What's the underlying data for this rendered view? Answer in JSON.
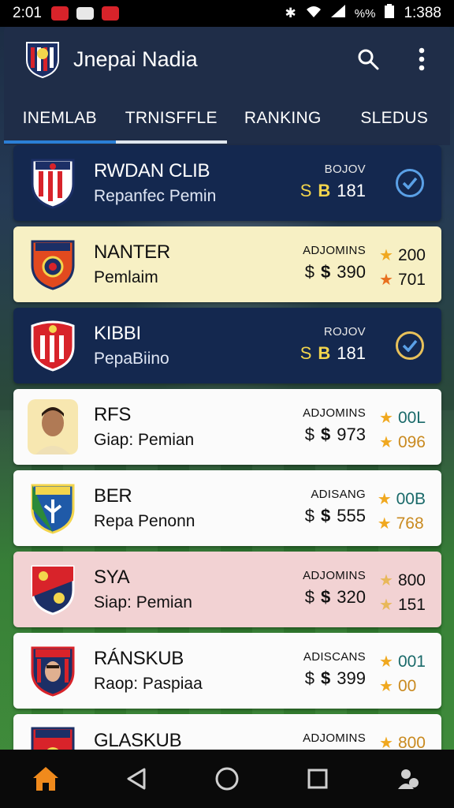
{
  "status_bar": {
    "time": "2:01",
    "right_text": "1:388",
    "signal_text": "%%",
    "battery_icon": "battery-icon"
  },
  "header": {
    "title": "Jnepai Nadia",
    "search_icon": "search-icon",
    "more_icon": "more-vert-icon"
  },
  "tabs": [
    {
      "label": "INEMLAB"
    },
    {
      "label": "TRNISFFLE"
    },
    {
      "label": "RANKING"
    },
    {
      "label": "SLEDUS"
    }
  ],
  "active_tab_index": 1,
  "clubs": [
    {
      "name": "RWDAN CLIB",
      "sub": "Repanfec Pemin",
      "label": "BOJOV",
      "sym1": "S",
      "sym2": "B",
      "price": "181",
      "theme": "dark",
      "action": "check-icon"
    },
    {
      "name": "NANTER",
      "sub": "Pemlaim",
      "label": "ADJOMINS",
      "sym1": "$",
      "sym2": "$",
      "price": "390",
      "theme": "cream",
      "stat1": "200",
      "stat2": "701"
    },
    {
      "name": "KIBBI",
      "sub": "PepaBiino",
      "label": "ROJOV",
      "sym1": "S",
      "sym2": "B",
      "price": "181",
      "theme": "dark",
      "action": "check-icon"
    },
    {
      "name": "RFS",
      "sub": "Giap: Pemian",
      "label": "ADJOMINS",
      "sym1": "$",
      "sym2": "$",
      "price": "973",
      "theme": "white",
      "stat1": "00L",
      "stat2": "096"
    },
    {
      "name": "BER",
      "sub": "Repa Penonn",
      "label": "ADISANG",
      "sym1": "$",
      "sym2": "$",
      "price": "555",
      "theme": "white",
      "stat1": "00B",
      "stat2": "768"
    },
    {
      "name": "SYA",
      "sub": "Siap: Pemian",
      "label": "ADJOMINS",
      "sym1": "$",
      "sym2": "$",
      "price": "320",
      "theme": "pink",
      "stat1": "800",
      "stat2": "151"
    },
    {
      "name": "RÁNSKUB",
      "sub": "Raop: Paspiaa",
      "label": "ADISCANS",
      "sym1": "$",
      "sym2": "$",
      "price": "399",
      "theme": "white",
      "stat1": "001",
      "stat2": "00"
    },
    {
      "name": "GLASKUB",
      "sub": "",
      "label": "ADJOMINS",
      "sym1": "",
      "sym2": "",
      "price": "",
      "theme": "white",
      "stat1": "800",
      "stat2": ""
    }
  ],
  "nav": {
    "home_icon": "home-icon",
    "back_icon": "back-icon",
    "home_circle_icon": "home-circle-icon",
    "recents_icon": "recents-icon",
    "profile_icon": "profile-icon"
  },
  "colors": {
    "header_bg": "#1f2d48",
    "card_dark": "#14284f",
    "card_cream": "#f7f0c4",
    "card_pink": "#f2d2d3",
    "accent_blue": "#2b7fd6",
    "star": "#f0a81f",
    "home_orange": "#f08a1c"
  }
}
